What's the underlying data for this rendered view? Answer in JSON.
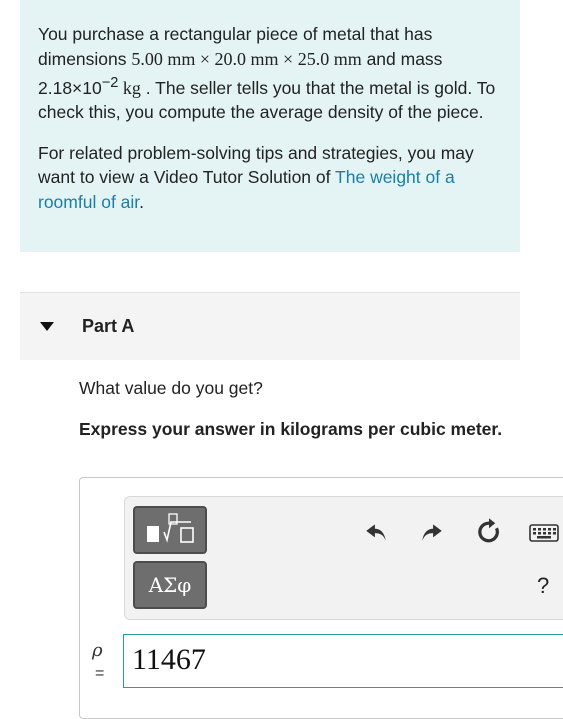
{
  "problem": {
    "p1_a": "You purchase a rectangular piece of metal that has dimensions ",
    "dimensions": "5.00 mm × 20.0 mm × 25.0 mm",
    "p1_b": " and mass ",
    "mass_coeff": "2.18×10",
    "mass_exp": "−2",
    "mass_unit": " kg",
    "p1_c": " . The seller tells you that the metal is gold. To check this, you compute the average density of the piece.",
    "p2_a": "For related problem-solving tips and strategies, you may want to view a Video Tutor Solution of ",
    "p2_link": "The weight of a roomful of air",
    "p2_b": "."
  },
  "part": {
    "title": "Part A",
    "question": "What value do you get?",
    "instruction": "Express your answer in kilograms per cubic meter."
  },
  "toolbar": {
    "greek_label": "ΑΣφ",
    "help_label": "?",
    "icons": [
      "templates-icon",
      "undo-icon",
      "redo-icon",
      "reset-icon",
      "keyboard-icon"
    ]
  },
  "answer": {
    "variable": "ρ",
    "equals": "=",
    "value": "11467"
  },
  "colors": {
    "problem_bg": "#e4f4f4",
    "link": "#1a7ea8",
    "input_border": "#2a9aa6"
  }
}
